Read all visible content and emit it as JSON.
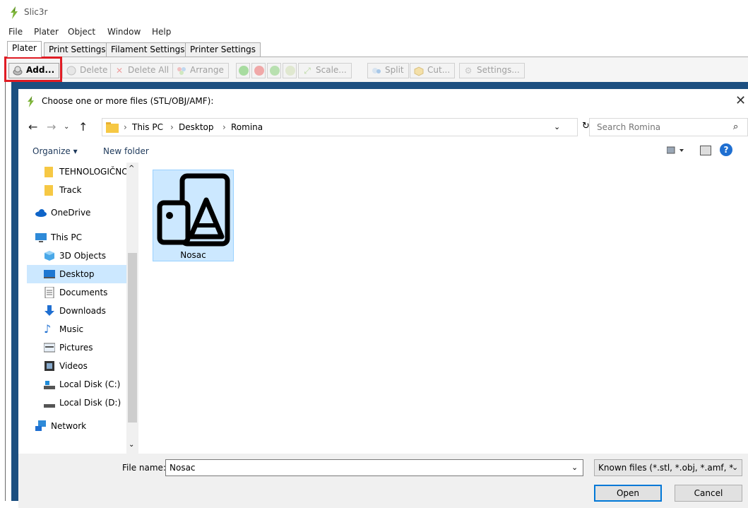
{
  "app": {
    "title": "Slic3r",
    "menu": [
      "File",
      "Plater",
      "Object",
      "Window",
      "Help"
    ],
    "tabs": [
      "Plater",
      "Print Settings",
      "Filament Settings",
      "Printer Settings"
    ],
    "toolbar": {
      "add": "Add...",
      "delete": "Delete",
      "delete_all": "Delete All",
      "arrange": "Arrange",
      "scale": "Scale...",
      "split": "Split",
      "cut": "Cut...",
      "settings": "Settings..."
    },
    "highlight_color": "#e01c24"
  },
  "dialog": {
    "title": "Choose one or more files (STL/OBJ/AMF):",
    "close_glyph": "✕",
    "breadcrumb": {
      "sep": "›",
      "items": [
        "This PC",
        "Desktop",
        "Romina"
      ]
    },
    "search": {
      "placeholder": "Search Romina"
    },
    "commands": {
      "organize": "Organize ▾",
      "new_folder": "New folder",
      "help": "?"
    },
    "nav_items": [
      {
        "label": "TEHNOLOGIČNO",
        "icon": "folder-icon"
      },
      {
        "label": "Track",
        "icon": "folder-icon"
      },
      {
        "label": "OneDrive",
        "icon": "cloud-icon"
      },
      {
        "label": "This PC",
        "icon": "computer-icon"
      },
      {
        "label": "3D Objects",
        "icon": "cube-icon"
      },
      {
        "label": "Desktop",
        "icon": "desktop-icon"
      },
      {
        "label": "Documents",
        "icon": "document-icon"
      },
      {
        "label": "Downloads",
        "icon": "download-icon"
      },
      {
        "label": "Music",
        "icon": "music-icon"
      },
      {
        "label": "Pictures",
        "icon": "pictures-icon"
      },
      {
        "label": "Videos",
        "icon": "videos-icon"
      },
      {
        "label": "Local Disk (C:)",
        "icon": "drive-icon"
      },
      {
        "label": "Local Disk (D:)",
        "icon": "drive-icon"
      },
      {
        "label": "Network",
        "icon": "network-icon"
      }
    ],
    "selected_nav": "Desktop",
    "files": [
      {
        "name": "Nosac",
        "icon": "3d-print-file-icon"
      }
    ],
    "filename_label": "File name:",
    "filename_value": "Nosac",
    "filetype_value": "Known files (*.stl, *.obj, *.amf, *",
    "open_label": "Open",
    "cancel_label": "Cancel",
    "accent_color": "#0078d7",
    "selection_color": "#cce8ff"
  }
}
